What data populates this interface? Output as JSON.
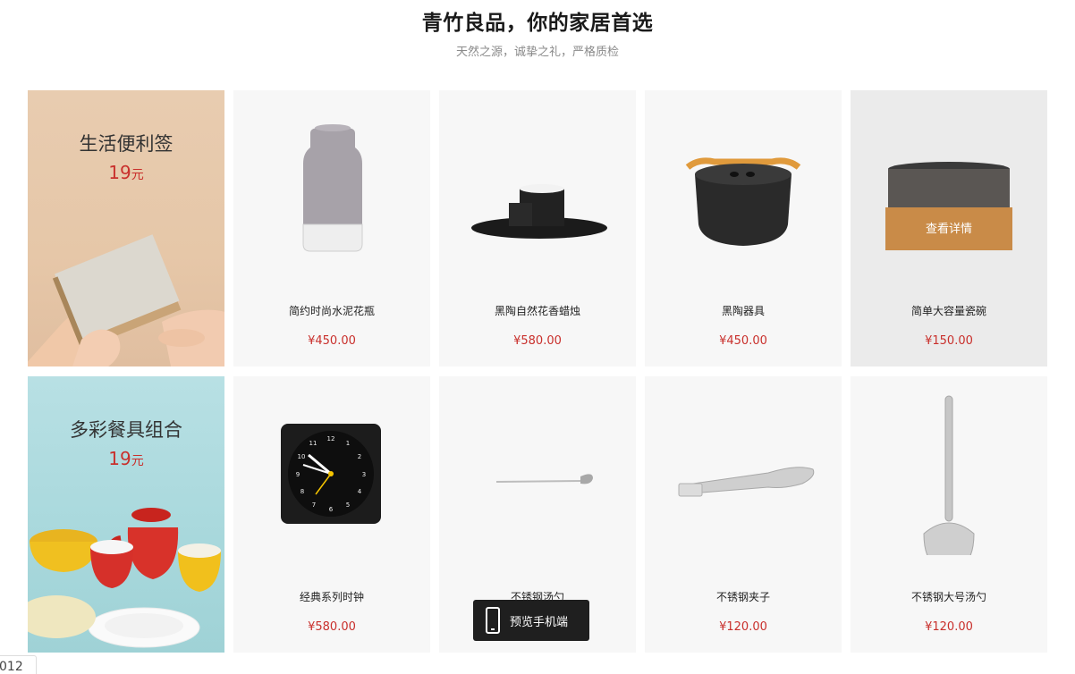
{
  "header": {
    "title": "青竹良品，你的家居首选",
    "subtitle": "天然之源，诚挚之礼，严格质检"
  },
  "promos": [
    {
      "title": "生活便利签",
      "price": "19",
      "unit": "元"
    },
    {
      "title": "多彩餐具组合",
      "price": "19",
      "unit": "元"
    }
  ],
  "products": [
    {
      "name": "简约时尚水泥花瓶",
      "price": "¥450.00",
      "icon": "vase-icon"
    },
    {
      "name": "黑陶自然花香蜡烛",
      "price": "¥580.00",
      "icon": "candle-icon"
    },
    {
      "name": "黑陶器具",
      "price": "¥450.00",
      "icon": "pot-icon"
    },
    {
      "name": "简单大容量瓷碗",
      "price": "¥150.00",
      "icon": "bowl-icon"
    },
    {
      "name": "经典系列时钟",
      "price": "¥580.00",
      "icon": "clock-icon"
    },
    {
      "name": "不锈钢汤勺",
      "price": "",
      "icon": "spoon-icon"
    },
    {
      "name": "不锈钢夹子",
      "price": "¥120.00",
      "icon": "tongs-icon"
    },
    {
      "name": "不锈钢大号汤勺",
      "price": "¥120.00",
      "icon": "ladle-icon"
    }
  ],
  "detail_button": "查看详情",
  "preview_button": "预览手机端",
  "page_tag": "012",
  "colors": {
    "price": "#c9302c",
    "accent": "#c98b48"
  }
}
